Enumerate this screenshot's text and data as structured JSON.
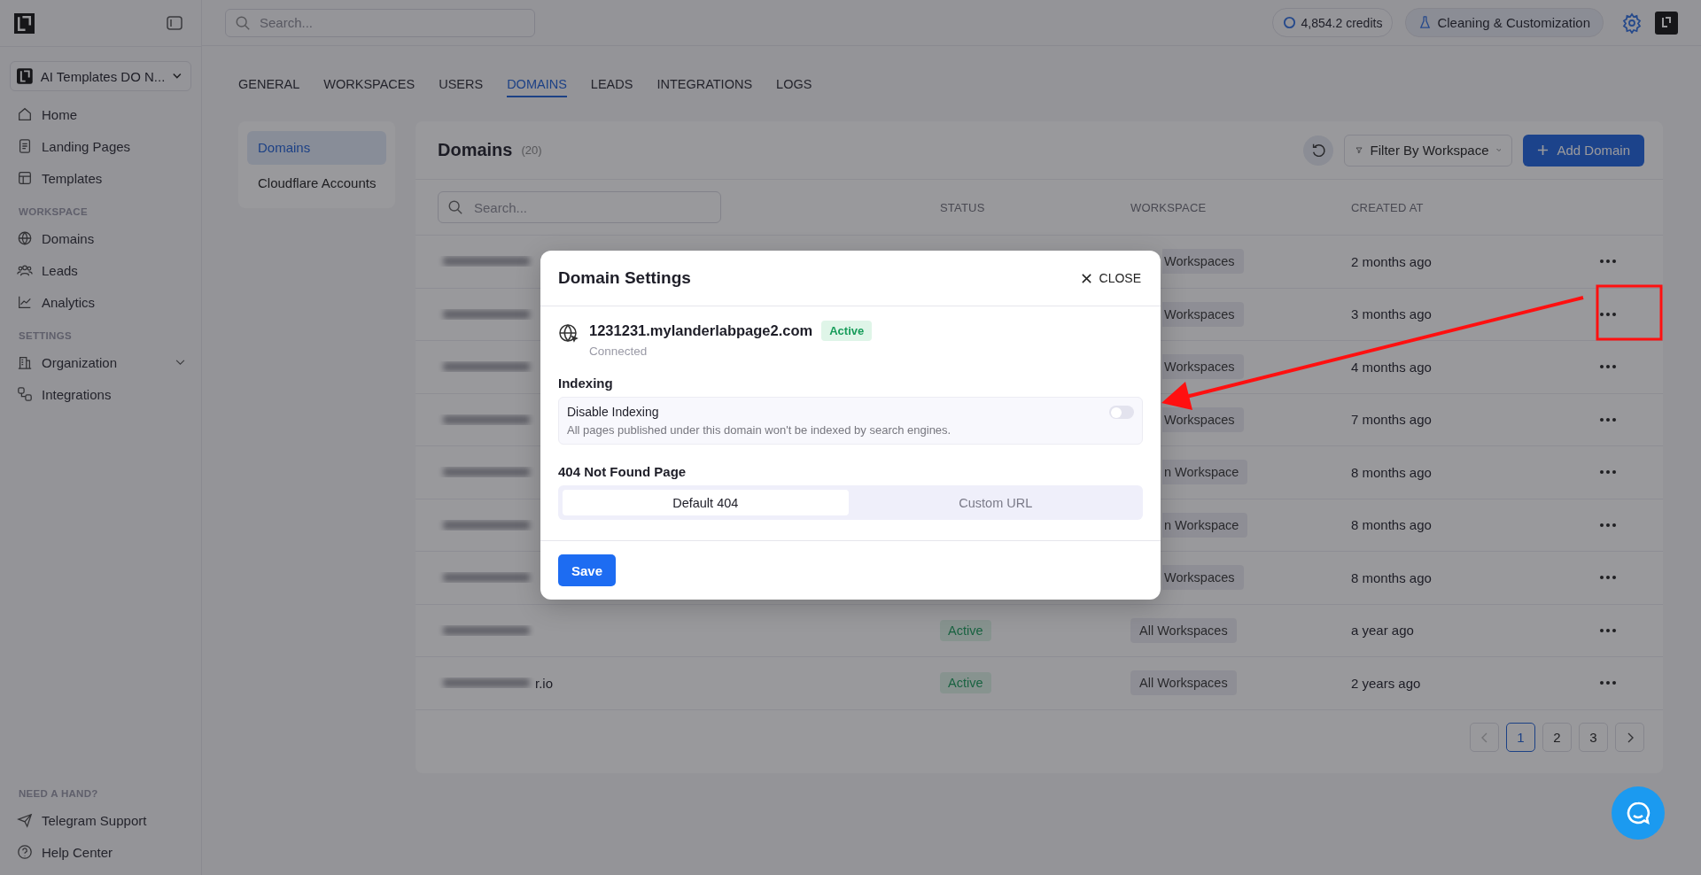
{
  "sidebar": {
    "workspace": "AI Templates DO N...",
    "groups": [
      {
        "items": [
          {
            "label": "Home",
            "selected": false
          },
          {
            "label": "Landing Pages",
            "selected": false
          },
          {
            "label": "Templates",
            "selected": false
          }
        ]
      },
      {
        "heading": "WORKSPACE",
        "items": [
          {
            "label": "Domains",
            "selected": false
          },
          {
            "label": "Leads",
            "selected": false
          },
          {
            "label": "Analytics",
            "selected": false
          }
        ]
      },
      {
        "heading": "SETTINGS",
        "items": [
          {
            "label": "Organization",
            "selected": false,
            "expandable": true
          },
          {
            "label": "Integrations",
            "selected": false
          }
        ]
      }
    ],
    "help": {
      "heading": "NEED A HAND?",
      "items": [
        {
          "label": "Telegram Support"
        },
        {
          "label": "Help Center"
        }
      ]
    }
  },
  "topbar": {
    "search": {
      "placeholder": "Search..."
    },
    "credits": "4,854.2 credits",
    "workspace": "Cleaning & Customization"
  },
  "tabs": [
    {
      "label": "GENERAL",
      "selected": false
    },
    {
      "label": "WORKSPACES",
      "selected": false
    },
    {
      "label": "USERS",
      "selected": false
    },
    {
      "label": "DOMAINS",
      "selected": true
    },
    {
      "label": "LEADS",
      "selected": false
    },
    {
      "label": "INTEGRATIONS",
      "selected": false
    },
    {
      "label": "LOGS",
      "selected": false
    }
  ],
  "settings_nav": [
    {
      "label": "Domains",
      "selected": true
    },
    {
      "label": "Cloudflare Accounts",
      "selected": false
    }
  ],
  "domains_card": {
    "title": "Domains",
    "count": "(20)",
    "filter": "Filter By Workspace",
    "add_button": "Add Domain",
    "search": {
      "placeholder": "Search..."
    },
    "columns": [
      "STATUS",
      "WORKSPACE",
      "CREATED AT"
    ],
    "rows": [
      {
        "workspace": "Workspaces",
        "created": "2 months ago"
      },
      {
        "workspace": "Workspaces",
        "created": "3 months ago"
      },
      {
        "workspace": "Workspaces",
        "created": "4 months ago"
      },
      {
        "workspace": "Workspaces",
        "created": "7 months ago"
      },
      {
        "workspace": "n Workspace",
        "created": "8 months ago"
      },
      {
        "workspace": "n Workspace",
        "created": "8 months ago"
      },
      {
        "workspace": "Workspaces",
        "created": "8 months ago"
      },
      {
        "status": "Active",
        "workspace": "All Workspaces",
        "created": "a year ago"
      },
      {
        "domain": "r.io",
        "status": "Active",
        "workspace": "All Workspaces",
        "created": "2 years ago"
      }
    ],
    "pagination": [
      {
        "label": "1",
        "selected": true
      },
      {
        "label": "2",
        "selected": false
      },
      {
        "label": "3",
        "selected": false
      }
    ]
  },
  "modal": {
    "title": "Domain Settings",
    "close": "CLOSE",
    "domain": "1231231.mylanderlabpage2.com",
    "status": "Active",
    "connection": "Connected",
    "indexing": {
      "heading": "Indexing",
      "label": "Disable Indexing",
      "description": "All pages published under this domain won't be indexed by search engines.",
      "on": false
    },
    "not_found": {
      "heading": "404 Not Found Page",
      "options": [
        {
          "label": "Default 404",
          "selected": true
        },
        {
          "label": "Custom URL",
          "selected": false
        }
      ]
    },
    "save": "Save"
  }
}
